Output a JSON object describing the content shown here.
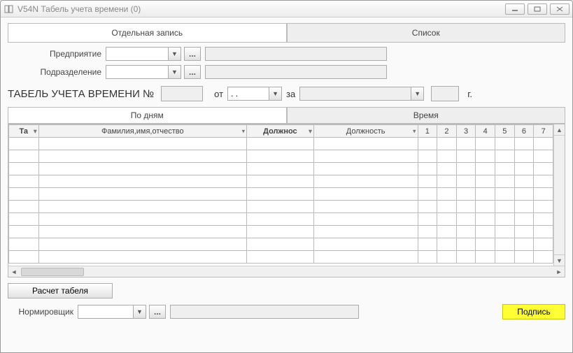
{
  "window": {
    "title": "V54N Табель учета времени (0)"
  },
  "main_tabs": {
    "single": "Отдельная запись",
    "list": "Список"
  },
  "labels": {
    "enterprise": "Предприятие",
    "department": "Подразделение",
    "timesheet_no": "ТАБЕЛЬ УЧЕТА ВРЕМЕНИ №",
    "from": "от",
    "for": "за",
    "year_suffix": "г.",
    "normalizer": "Нормировщик"
  },
  "fields": {
    "enterprise_value": "",
    "enterprise_display": "",
    "department_value": "",
    "department_display": "",
    "number": "",
    "date_from": ". .",
    "month_for": "",
    "year": "",
    "normalizer_value": "",
    "normalizer_display": ""
  },
  "sub_tabs": {
    "by_days": "По дням",
    "time": "Время"
  },
  "grid": {
    "columns": {
      "tab_no": "Та",
      "fio": "Фамилия,имя,отчество",
      "position_code": "Должнос",
      "position": "Должность",
      "days": [
        "1",
        "2",
        "3",
        "4",
        "5",
        "6",
        "7"
      ]
    },
    "row_count": 10
  },
  "buttons": {
    "calc": "Расчет табеля",
    "sign": "Подпись",
    "ellipsis": "..."
  }
}
